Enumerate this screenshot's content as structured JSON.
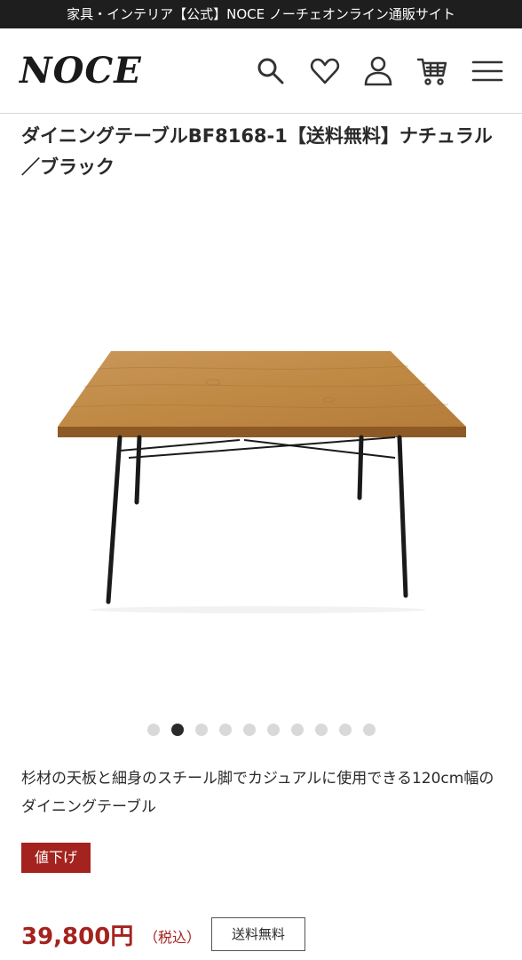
{
  "topbar": {
    "text": "家具・インテリア【公式】NOCE ノーチェオンライン通販サイト"
  },
  "header": {
    "logo": "NOCE",
    "icons": [
      "search-icon",
      "heart-icon",
      "user-icon",
      "cart-icon",
      "menu-icon"
    ]
  },
  "product": {
    "title": "ダイニングテーブルBF8168-1【送料無料】ナチュラル／ブラック",
    "carousel": {
      "total": 10,
      "active_index": 1
    },
    "description": "杉材の天板と細身のスチール脚でカジュアルに使用できる120cm幅のダイニングテーブル",
    "badge": "値下げ",
    "price": "39,800円",
    "tax_note": "（税込）",
    "shipping_tag": "送料無料"
  },
  "colors": {
    "topbar_bg": "#1e1e1e",
    "accent": "#a4231f",
    "wood": "#c08a45"
  }
}
